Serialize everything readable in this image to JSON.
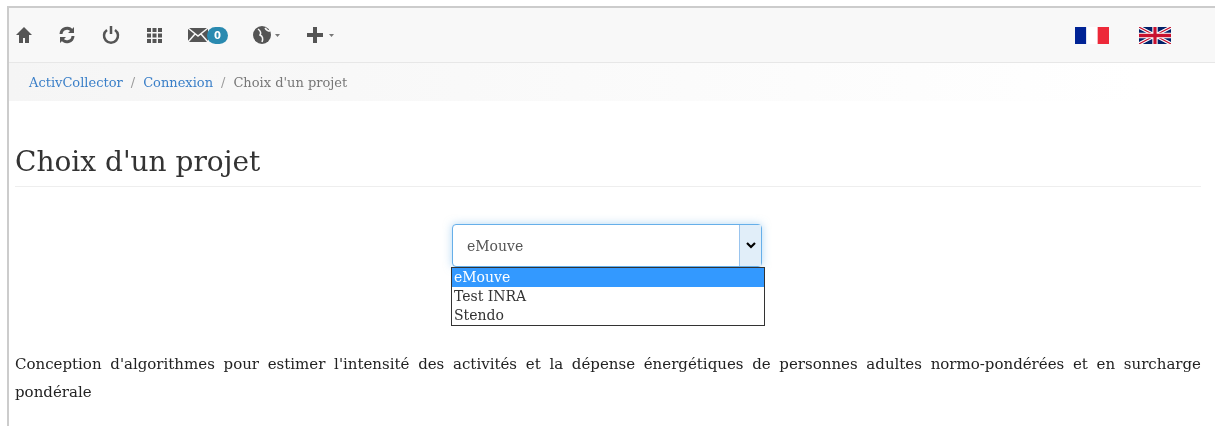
{
  "navbar": {
    "mail_badge": "0"
  },
  "breadcrumb": [
    {
      "label": "ActivCollector",
      "kind": "link"
    },
    {
      "separator": "/",
      "label": "Connexion",
      "kind": "link"
    },
    {
      "separator": "/",
      "label": "Choix d'un projet",
      "kind": "current"
    }
  ],
  "heading": "Choix d'un projet",
  "project_select": {
    "value": "eMouve",
    "expanded": true,
    "options": [
      {
        "label": "eMouve",
        "selected": true
      },
      {
        "label": "Test INRA",
        "selected": false
      },
      {
        "label": "Stendo",
        "selected": false
      }
    ]
  },
  "description": "Conception d'algorithmes pour estimer l'intensité des activités et la dépense énergétiques de personnes adultes normo-pondérées et en surcharge pondérale"
}
